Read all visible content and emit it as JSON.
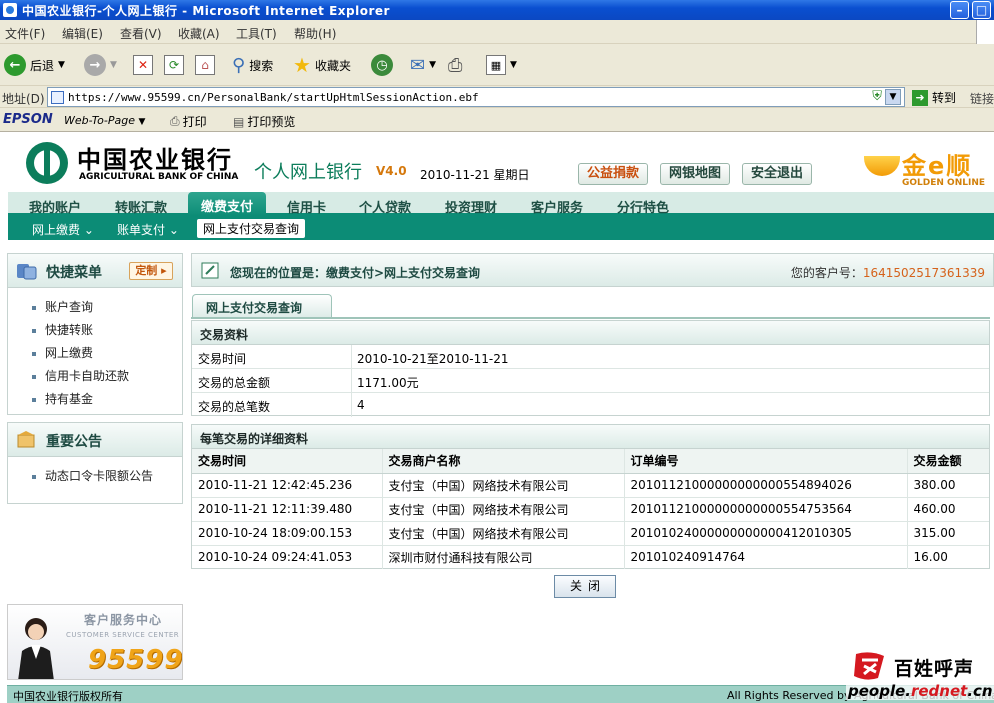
{
  "browser": {
    "title": "中国农业银行-个人网上银行 - Microsoft Internet Explorer",
    "menu": [
      "文件(F)",
      "编辑(E)",
      "查看(V)",
      "收藏(A)",
      "工具(T)",
      "帮助(H)"
    ],
    "toolbar": {
      "back": "后退",
      "search": "搜索",
      "favorites": "收藏夹"
    },
    "address": {
      "label": "地址(D)",
      "url": "https://www.95599.cn/PersonalBank/startUpHtmlSessionAction.ebf",
      "go": "转到",
      "links": "链接"
    },
    "epson": {
      "brand": "EPSON",
      "web_to_page": "Web-To-Page",
      "print": "打印",
      "print_preview": "打印预览"
    }
  },
  "bank": {
    "name_cn": "中国农业银行",
    "name_en": "AGRICULTURAL BANK OF CHINA",
    "product": "个人网上银行",
    "version": "V4.0",
    "date": "2010-11-21 星期日",
    "buttons": [
      "公益捐款",
      "网银地图",
      "安全退出"
    ],
    "golden_cn": "金e顺",
    "golden_en": "GOLDEN ONLINE"
  },
  "nav": {
    "main": [
      "我的账户",
      "转账汇款",
      "缴费支付",
      "信用卡",
      "个人贷款",
      "投资理财",
      "客户服务",
      "分行特色"
    ],
    "active": "缴费支付",
    "sub": [
      "网上缴费 ⌄",
      "账单支付 ⌄",
      "网上支付交易查询"
    ]
  },
  "sidebar": {
    "quick_title": "快捷菜单",
    "custom": "定制",
    "quick_items": [
      "账户查询",
      "快捷转账",
      "网上缴费",
      "信用卡自助还款",
      "持有基金"
    ],
    "notice_title": "重要公告",
    "notice_items": [
      "动态口令卡限额公告"
    ],
    "service_title": "客户服务中心",
    "service_en": "CUSTOMER SERVICE CENTER",
    "service_phone": "95599"
  },
  "location": {
    "text": "您现在的位置是：缴费支付>网上支付交易查询",
    "customer_label": "您的客户号：",
    "customer_no": "1641502517361339"
  },
  "content": {
    "tab": "网上支付交易查询",
    "summary": {
      "title": "交易资料",
      "rows": [
        {
          "label": "交易时间",
          "value": "2010-10-21至2010-11-21"
        },
        {
          "label": "交易的总金额",
          "value": "1171.00元"
        },
        {
          "label": "交易的总笔数",
          "value": "4"
        }
      ]
    },
    "detail": {
      "title": "每笔交易的详细资料",
      "columns": [
        "交易时间",
        "交易商户名称",
        "订单编号",
        "交易金额"
      ],
      "rows": [
        [
          "2010-11-21 12:42:45.236",
          "支付宝（中国）网络技术有限公司",
          "20101121000000000000554894026",
          "380.00"
        ],
        [
          "2010-11-21 12:11:39.480",
          "支付宝（中国）网络技术有限公司",
          "20101121000000000000554753564",
          "460.00"
        ],
        [
          "2010-10-24 18:09:00.153",
          "支付宝（中国）网络技术有限公司",
          "20101024000000000000412010305",
          "315.00"
        ],
        [
          "2010-10-24 09:24:41.053",
          "深圳市财付通科技有限公司",
          "201010240914764",
          "16.00"
        ]
      ]
    },
    "close": "关闭"
  },
  "footer": {
    "left": "中国农业银行版权所有",
    "right": "All Rights Reserved by Agricultural Bank of China"
  },
  "watermark": {
    "cn": "百姓呼声",
    "site_a": "people.",
    "site_b": "rednet",
    "site_c": ".cn"
  }
}
